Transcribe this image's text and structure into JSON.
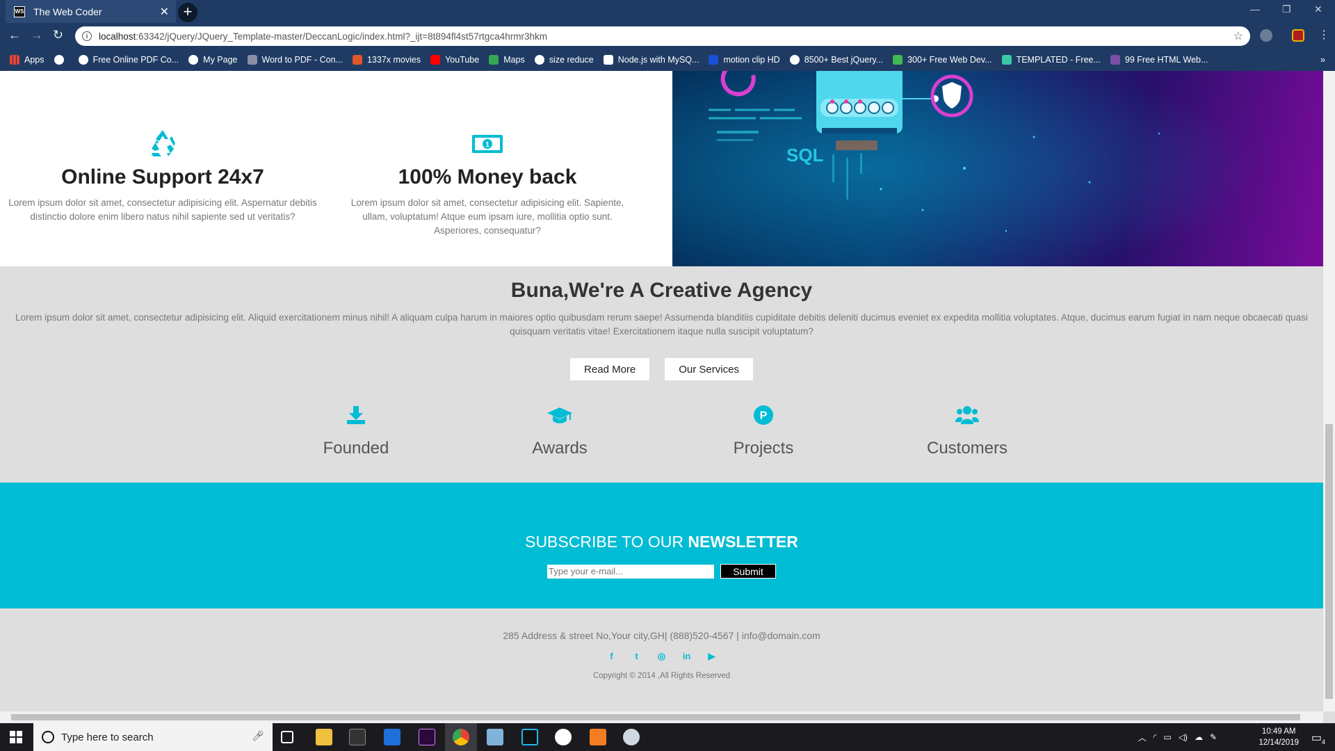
{
  "browser": {
    "tab_title": "The Web Coder",
    "tab_favicon": "WS",
    "url_host": "localhost",
    "url_rest": ":63342/jQuery/JQuery_Template-master/DeccanLogic/index.html?_ijt=8t894fl4st57rtgca4hrmr3hkm",
    "bookmarks": [
      "Apps",
      "",
      "Free Online PDF Co...",
      "My Page",
      "Word to PDF - Con...",
      "1337x movies",
      "YouTube",
      "Maps",
      "size reduce",
      "Node.js with MySQ...",
      "motion clip HD",
      "8500+ Best jQuery...",
      "300+ Free Web Dev...",
      "TEMPLATED - Free...",
      "99 Free HTML Web..."
    ],
    "bookmarks_more": "»"
  },
  "features": [
    {
      "icon": "recycle-icon",
      "title": "Online Support 24x7",
      "text": "Lorem ipsum dolor sit amet, consectetur adipisicing elit. Aspernatur debitis distinctio dolore enim libero natus nihil sapiente sed ut veritatis?"
    },
    {
      "icon": "money-icon",
      "title": "100% Money back",
      "text": "Lorem ipsum dolor sit amet, consectetur adipisicing elit. Sapiente, ullam, voluptatum! Atque eum ipsam iure, mollitia optio sunt. Asperiores, consequatur?"
    }
  ],
  "hero": {
    "label": "SQL"
  },
  "agency": {
    "title": "Buna,We're A Creative Agency",
    "text": "Lorem ipsum dolor sit amet, consectetur adipisicing elit. Aliquid exercitationem minus nihil! A aliquam culpa harum in maiores optio quibusdam rerum saepe! Assumenda blanditiis cupiditate debitis deleniti ducimus eveniet ex expedita mollitia voluptates. Atque, ducimus earum fugiat in nam neque obcaecati quasi quisquam veritatis vitae! Exercitationem itaque nulla suscipit voluptatum?",
    "read_more": "Read More",
    "our_services": "Our Services"
  },
  "stats": [
    {
      "icon": "download-icon",
      "label": "Founded"
    },
    {
      "icon": "graduation-cap-icon",
      "label": "Awards"
    },
    {
      "icon": "paypal-icon",
      "label": "Projects"
    },
    {
      "icon": "users-icon",
      "label": "Customers"
    }
  ],
  "newsletter": {
    "title_plain": "SUBSCRIBE TO OUR ",
    "title_bold": "NEWSLETTER",
    "placeholder": "Type your e-mail...",
    "submit": "Submit"
  },
  "footer": {
    "address": "285 Address & street No,Your city,GH| (888)520-4567 | info@domain.com",
    "social": [
      "f",
      "t",
      "◎",
      "in",
      "▶"
    ],
    "copyright": "Copyright © 2014 ,All Rights Reserved"
  },
  "taskbar": {
    "search_placeholder": "Type here to search",
    "time": "10:49 AM",
    "date": "12/14/2019",
    "notification_count": "4"
  },
  "colors": {
    "accent": "#00bcd4",
    "chrome": "#1f3b63",
    "taskbar": "#1b1b1f"
  }
}
